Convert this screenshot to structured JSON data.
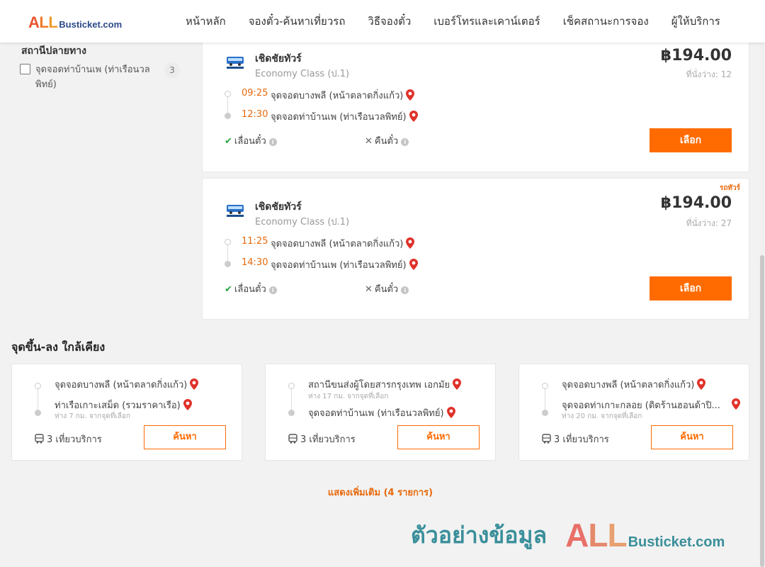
{
  "header": {
    "logo_all": [
      "A",
      "L",
      "L"
    ],
    "logo_text": "Busticket.com",
    "nav": [
      "หน้าหลัก",
      "จองตั๋ว-ค้นหาเที่ยวรถ",
      "วิธีจองตั๋ว",
      "เบอร์โทรและเคาน์เตอร์",
      "เช็คสถานะการจอง",
      "ผู้ให้บริการ"
    ]
  },
  "filter": {
    "title": "สถานีปลายทาง",
    "items": [
      {
        "label": "จุดจอดท่าบ้านเพ (ท่าเรือนวลพิทย์)",
        "count": "3",
        "checked": false
      }
    ]
  },
  "trips": [
    {
      "operator": "เชิดชัยทัวร์",
      "class": "Economy Class (ป.1)",
      "price": "฿194.00",
      "seats": "ที่นั่งว่าง: 12",
      "badge": "",
      "depart_time": "09:25",
      "depart_stop": "จุดจอดบางพลี (หน้าตลาดกิ่งแก้ว)",
      "arrive_time": "12:30",
      "arrive_stop": "จุดจอดท่าบ้านเพ (ท่าเรือนวลพิทย์)",
      "policy_change": "เลื่อนตั๋ว",
      "policy_refund": "คืนตั๋ว",
      "button": "เลือก"
    },
    {
      "operator": "เชิดชัยทัวร์",
      "class": "Economy Class (ป.1)",
      "price": "฿194.00",
      "seats": "ที่นั่งว่าง: 27",
      "badge": "รถทัวร์",
      "depart_time": "11:25",
      "depart_stop": "จุดจอดบางพลี (หน้าตลาดกิ่งแก้ว)",
      "arrive_time": "14:30",
      "arrive_stop": "จุดจอดท่าบ้านเพ (ท่าเรือนวลพิทย์)",
      "policy_change": "เลื่อนตั๋ว",
      "policy_refund": "คืนตั๋ว",
      "button": "เลือก"
    }
  ],
  "nearby": {
    "title": "จุดขึ้น-ลง ใกล้เคียง",
    "cards": [
      {
        "from": "จุดจอดบางพลี (หน้าตลาดกิ่งแก้ว)",
        "from_dist": "",
        "to": "ท่าเรือเกาะเสม็ด (รวมราคาเรือ)",
        "to_dist": "ห่าง 7 กม. จากจุดที่เลือก",
        "trips": "3 เที่ยวบริการ",
        "button": "ค้นหา"
      },
      {
        "from": "สถานีขนส่งผู้โดยสารกรุงเทพ เอกมัย",
        "from_dist": "ห่าง 17 กม. จากจุดที่เลือก",
        "to": "จุดจอดท่าบ้านเพ (ท่าเรือนวลพิทย์)",
        "to_dist": "",
        "trips": "3 เที่ยวบริการ",
        "button": "ค้นหา"
      },
      {
        "from": "จุดจอดบางพลี (หน้าตลาดกิ่งแก้ว)",
        "from_dist": "",
        "to": "จุดจอดท่าเกาะกลอย (ติดร้านฮอนด้าปิ...",
        "to_dist": "ห่าง 20 กม. จากจุดที่เลือก",
        "trips": "3 เที่ยวบริการ",
        "button": "ค้นหา"
      }
    ],
    "show_more": "แสดงเพิ่มเติม (4 รายการ)"
  },
  "watermark": {
    "text": "ตัวอย่างข้อมูล",
    "logo_all": [
      "A",
      "L",
      "L"
    ],
    "logo_text": "Busticket.com"
  },
  "colors": {
    "accent": "#ff6b00",
    "time": "#e8690c",
    "pin": "#e0312a",
    "check": "#2aa340"
  }
}
